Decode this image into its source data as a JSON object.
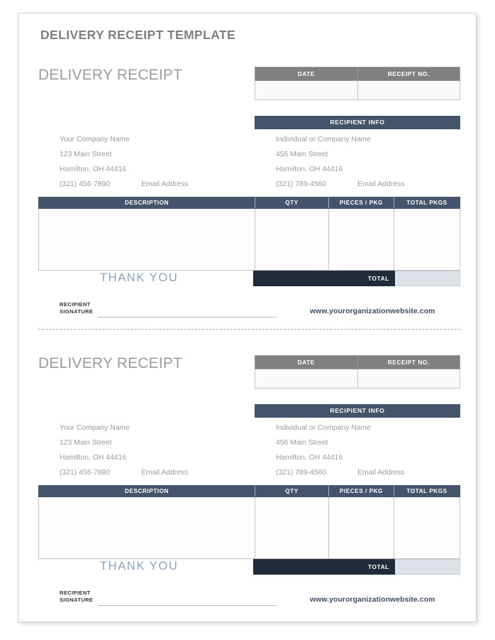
{
  "document": {
    "template_title": "DELIVERY RECEIPT TEMPLATE"
  },
  "receipts": [
    {
      "heading": "DELIVERY RECEIPT",
      "meta_table": {
        "headers": [
          "DATE",
          "RECEIPT NO."
        ],
        "values": [
          "",
          ""
        ]
      },
      "recipient_bar_label": "RECIPIENT INFO",
      "sender_address": {
        "name": "Your Company Name",
        "street": "123 Main Street",
        "city_state_zip": "Hamilton, OH  44416",
        "phone": "(321) 456-7890",
        "email": "Email Address"
      },
      "recipient_address": {
        "name": "Individual or Company Name",
        "street": "456 Main Street",
        "city_state_zip": "Hamilton, OH  44416",
        "phone": "(321) 789-4560",
        "email": "Email Address"
      },
      "items_table": {
        "headers": [
          "DESCRIPTION",
          "QTY",
          "PIECES / PKG",
          "TOTAL PKGS"
        ],
        "rows": []
      },
      "thank_you": "THANK YOU",
      "total_label": "TOTAL",
      "total_value": "",
      "signature_label_line1": "RECIPIENT",
      "signature_label_line2": "SIGNATURE",
      "website": "www.yourorganizationwebsite.com"
    },
    {
      "heading": "DELIVERY RECEIPT",
      "meta_table": {
        "headers": [
          "DATE",
          "RECEIPT NO."
        ],
        "values": [
          "",
          ""
        ]
      },
      "recipient_bar_label": "RECIPIENT INFO",
      "sender_address": {
        "name": "Your Company Name",
        "street": "123 Main Street",
        "city_state_zip": "Hamilton, OH  44416",
        "phone": "(321) 456-7890",
        "email": "Email Address"
      },
      "recipient_address": {
        "name": "Individual or Company Name",
        "street": "456 Main Street",
        "city_state_zip": "Hamilton, OH  44416",
        "phone": "(321) 789-4560",
        "email": "Email Address"
      },
      "items_table": {
        "headers": [
          "DESCRIPTION",
          "QTY",
          "PIECES / PKG",
          "TOTAL PKGS"
        ],
        "rows": []
      },
      "thank_you": "THANK YOU",
      "total_label": "TOTAL",
      "total_value": "",
      "signature_label_line1": "RECIPIENT",
      "signature_label_line2": "SIGNATURE",
      "website": "www.yourorganizationwebsite.com"
    }
  ],
  "colors": {
    "gray_header": "#808080",
    "navy_header": "#44546a",
    "total_dark": "#222b3a",
    "total_value_fill": "#dce1e8",
    "thank_you_blue": "#8da2bd",
    "website_blue": "#3d4d63",
    "body_text_gray": "#9a9a9a"
  }
}
